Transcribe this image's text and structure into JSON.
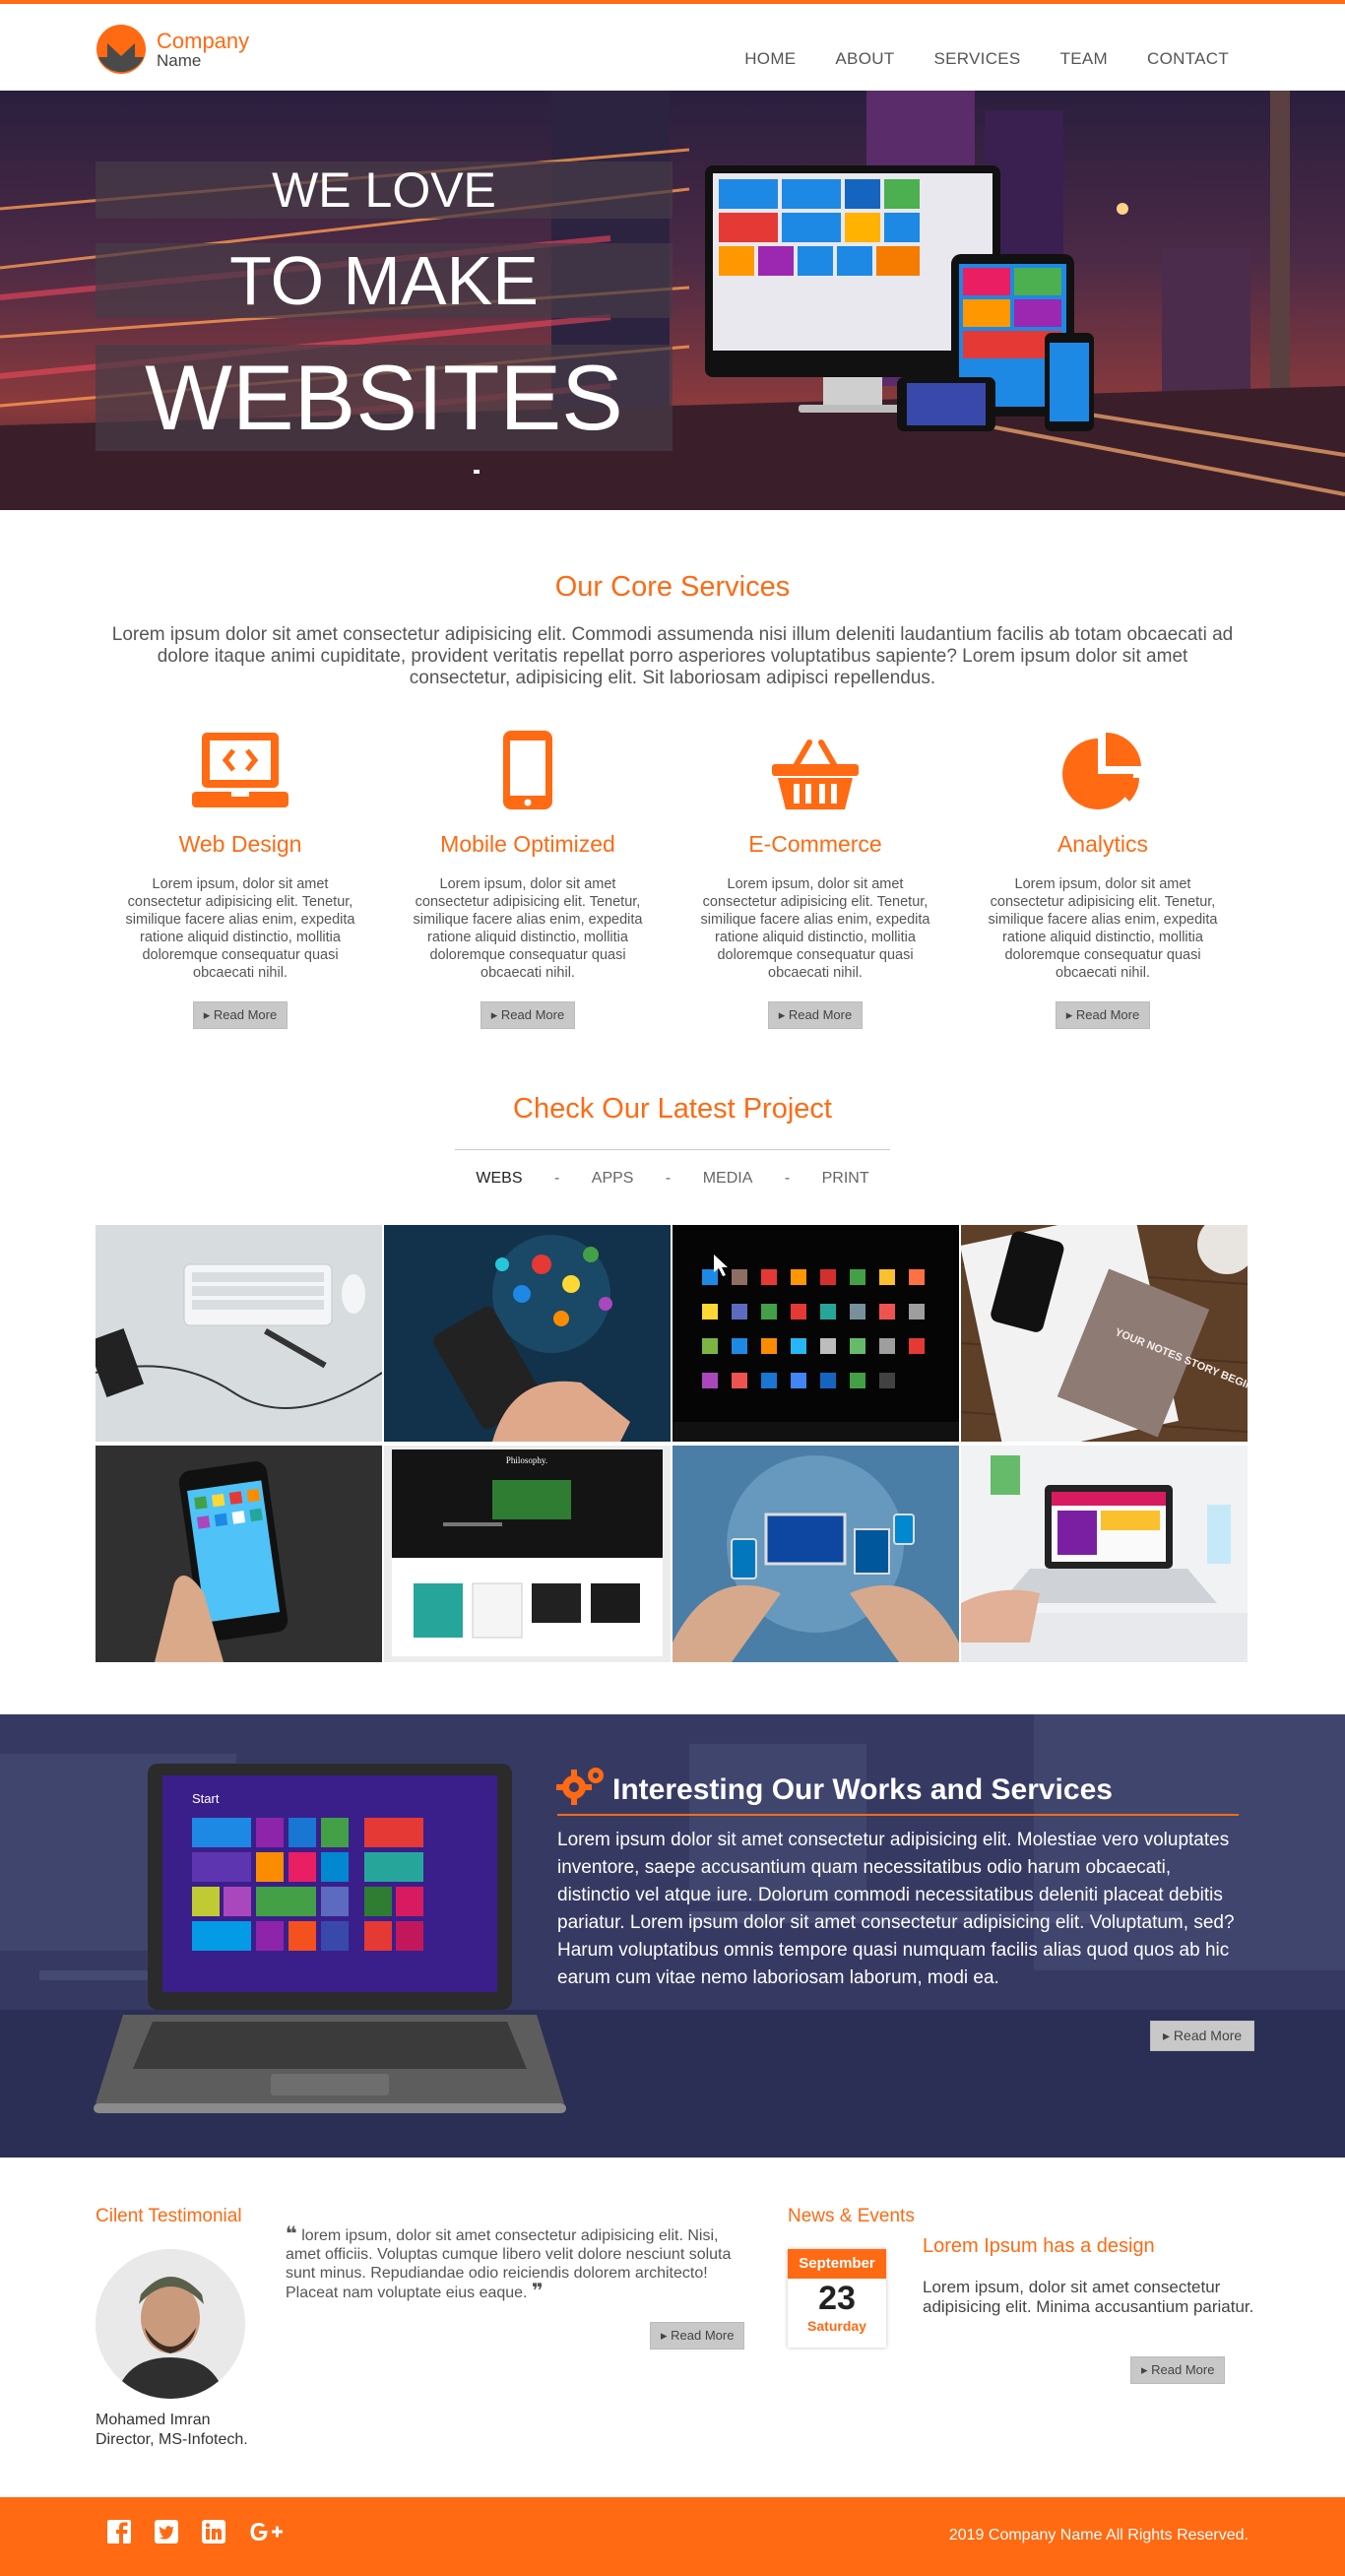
{
  "brand": {
    "company": "Company",
    "name": "Name",
    "accent": "#ff6a13"
  },
  "nav": {
    "items": [
      "HOME",
      "ABOUT",
      "SERVICES",
      "TEAM",
      "CONTACT"
    ]
  },
  "hero": {
    "line1": "WE LOVE",
    "line2": "TO MAKE",
    "line3": "WEBSITES"
  },
  "services": {
    "title": "Our Core Services",
    "intro": "Lorem ipsum dolor sit amet consectetur adipisicing elit. Commodi assumenda nisi illum deleniti laudantium facilis ab totam obcaecati ad dolore itaque animi cupiditate, provident veritatis repellat porro asperiores voluptatibus sapiente? Lorem ipsum dolor sit amet consectetur, adipisicing elit. Sit laboriosam adipisci repellendus.",
    "items": [
      {
        "title": "Web Design",
        "icon": "laptop-code-icon",
        "text": "Lorem ipsum, dolor sit amet consectetur adipisicing elit. Tenetur, similique facere alias enim, expedita ratione aliquid distinctio, mollitia doloremque consequatur quasi obcaecati nihil.",
        "button": "Read More"
      },
      {
        "title": "Mobile Optimized",
        "icon": "mobile-icon",
        "text": "Lorem ipsum, dolor sit amet consectetur adipisicing elit. Tenetur, similique facere alias enim, expedita ratione aliquid distinctio, mollitia doloremque consequatur quasi obcaecati nihil.",
        "button": "Read More"
      },
      {
        "title": "E-Commerce",
        "icon": "shopping-basket-icon",
        "text": "Lorem ipsum, dolor sit amet consectetur adipisicing elit. Tenetur, similique facere alias enim, expedita ratione aliquid distinctio, mollitia doloremque consequatur quasi obcaecati nihil.",
        "button": "Read More"
      },
      {
        "title": "Analytics",
        "icon": "pie-chart-icon",
        "text": "Lorem ipsum, dolor sit amet consectetur adipisicing elit. Tenetur, similique facere alias enim, expedita ratione aliquid distinctio, mollitia doloremque consequatur quasi obcaecati nihil.",
        "button": "Read More"
      }
    ]
  },
  "projects": {
    "title": "Check Our Latest Project",
    "filters": [
      "WEBS",
      "APPS",
      "MEDIA",
      "PRINT"
    ],
    "separator": "-",
    "active_filter": "WEBS",
    "note_card": "YOUR NOTES STORY BEGINS HERE",
    "blog_title": "Philosophy."
  },
  "works": {
    "title": "Interesting Our Works and Services",
    "text": "Lorem ipsum dolor sit amet consectetur adipisicing elit. Molestiae vero voluptates inventore, saepe accusantium quam necessitatibus odio harum obcaecati, distinctio vel atque iure. Dolorum commodi necessitatibus deleniti placeat debitis pariatur. Lorem ipsum dolor sit amet consectetur adipisicing elit. Voluptatum, sed? Harum voluptatibus omnis tempore quasi numquam facilis alias quod quos ab hic earum cum vitae nemo laboriosam laborum, modi ea.",
    "button": "Read More",
    "laptop_screen": "Start"
  },
  "testimonial": {
    "heading": "Cilent Testimonial",
    "quote": "lorem ipsum, dolor sit amet consectetur adipisicing elit. Nisi, amet officiis. Voluptas cumque libero velit dolore nesciunt soluta sunt minus. Repudiandae odio reiciendis dolorem architecto! Placeat nam voluptate eius eaque.",
    "quote_open": "❝",
    "quote_close": "❞",
    "name": "Mohamed Imran",
    "role": "Director, MS-Infotech.",
    "button": "Read More"
  },
  "news": {
    "heading": "News & Events",
    "month": "September",
    "day": "23",
    "weekday": "Saturday",
    "title": "Lorem Ipsum has a design",
    "text": "Lorem ipsum, dolor sit amet consectetur adipisicing elit. Minima accusantium pariatur.",
    "button": "Read More"
  },
  "footer": {
    "social": [
      "facebook-icon",
      "twitter-icon",
      "linkedin-icon",
      "google-plus-icon"
    ],
    "copyright": "2019 Company Name All Rights Reserved."
  }
}
